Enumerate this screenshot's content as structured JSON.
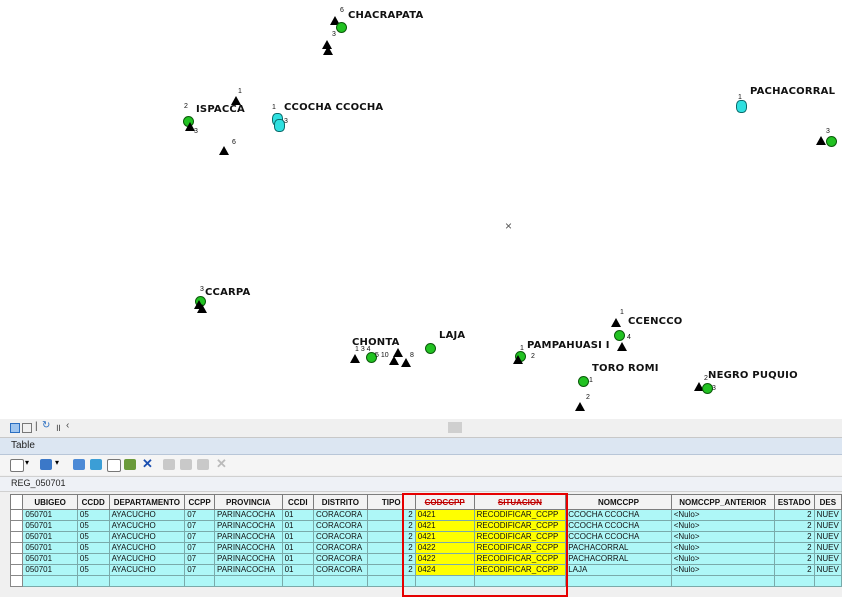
{
  "map": {
    "places": [
      "CHACRAPATA",
      "ISPACCA",
      "CCOCHA CCOCHA",
      "PACHACORRAL",
      "CCARPA",
      "CHONTA",
      "LAJA",
      "PAMPAHUASI I",
      "CCENCCO",
      "TORO ROMI",
      "NEGRO PUQUIO"
    ],
    "cursor": "×"
  },
  "tabbar": {
    "icons": [
      "grid-view-icon",
      "table-view-icon",
      "refresh-icon",
      "pause-icon",
      "back-icon"
    ]
  },
  "panel_title": "Table",
  "layer_name": "REG_050701",
  "table": {
    "columns": [
      "UBIGEO",
      "CCDD",
      "DEPARTAMENTO",
      "CCPP",
      "PROVINCIA",
      "CCDI",
      "DISTRITO",
      "TIPO",
      "CODCCPP",
      "SITUACION",
      "NOMCCPP",
      "NOMCCPP_ANTERIOR",
      "ESTADO",
      "DES"
    ],
    "rows": [
      [
        "050701",
        "05",
        "AYACUCHO",
        "07",
        "PARINACOCHA",
        "01",
        "CORACORA",
        "2",
        "0421",
        "RECODIFICAR_CCPP",
        "CCOCHA CCOCHA",
        "<Nulo>",
        "2",
        "NUEV"
      ],
      [
        "050701",
        "05",
        "AYACUCHO",
        "07",
        "PARINACOCHA",
        "01",
        "CORACORA",
        "2",
        "0421",
        "RECODIFICAR_CCPP",
        "CCOCHA CCOCHA",
        "<Nulo>",
        "2",
        "NUEV"
      ],
      [
        "050701",
        "05",
        "AYACUCHO",
        "07",
        "PARINACOCHA",
        "01",
        "CORACORA",
        "2",
        "0421",
        "RECODIFICAR_CCPP",
        "CCOCHA CCOCHA",
        "<Nulo>",
        "2",
        "NUEV"
      ],
      [
        "050701",
        "05",
        "AYACUCHO",
        "07",
        "PARINACOCHA",
        "01",
        "CORACORA",
        "2",
        "0422",
        "RECODIFICAR_CCPP",
        "PACHACORRAL",
        "<Nulo>",
        "2",
        "NUEV"
      ],
      [
        "050701",
        "05",
        "AYACUCHO",
        "07",
        "PARINACOCHA",
        "01",
        "CORACORA",
        "2",
        "0422",
        "RECODIFICAR_CCPP",
        "PACHACORRAL",
        "<Nulo>",
        "2",
        "NUEV"
      ],
      [
        "050701",
        "05",
        "AYACUCHO",
        "07",
        "PARINACOCHA",
        "01",
        "CORACORA",
        "2",
        "0424",
        "RECODIFICAR_CCPP",
        "LAJA",
        "<Nulo>",
        "2",
        "NUEV"
      ]
    ]
  },
  "colors": {
    "highlight": "#ffff00",
    "row_bg": "#aef7f7",
    "red_box": "#e60000",
    "title_bg": "#dce6f2"
  }
}
